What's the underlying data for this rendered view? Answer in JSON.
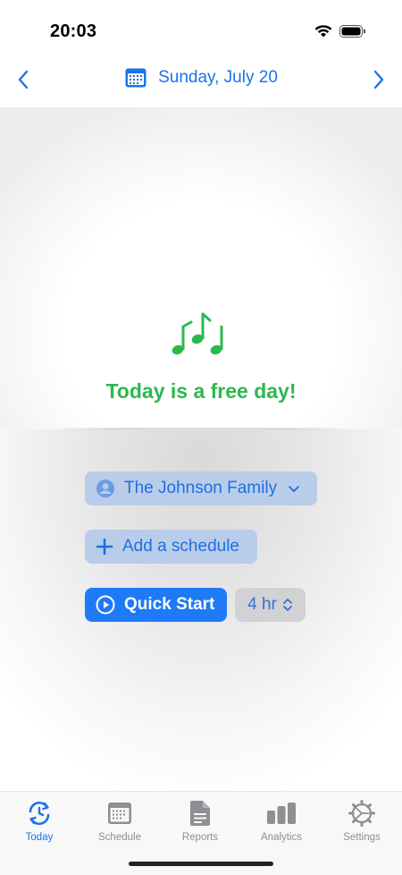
{
  "status": {
    "time": "20:03"
  },
  "header": {
    "date": "Sunday, July 20"
  },
  "main": {
    "free_day_text": "Today is a free day!",
    "family_label": "The Johnson Family",
    "add_schedule_label": "Add a schedule",
    "quick_start_label": "Quick Start",
    "duration_label": "4 hr"
  },
  "tabs": [
    {
      "label": "Today",
      "icon": "clock-arrows-icon",
      "active": true
    },
    {
      "label": "Schedule",
      "icon": "calendar-icon"
    },
    {
      "label": "Reports",
      "icon": "document-icon"
    },
    {
      "label": "Analytics",
      "icon": "bar-chart-icon"
    },
    {
      "label": "Settings",
      "icon": "gear-icon"
    }
  ],
  "colors": {
    "accent": "#1a73e8",
    "free_day_green": "#2db84d",
    "quick_start_bg": "#1e7af6",
    "pill_bg": "#b9cdea"
  }
}
